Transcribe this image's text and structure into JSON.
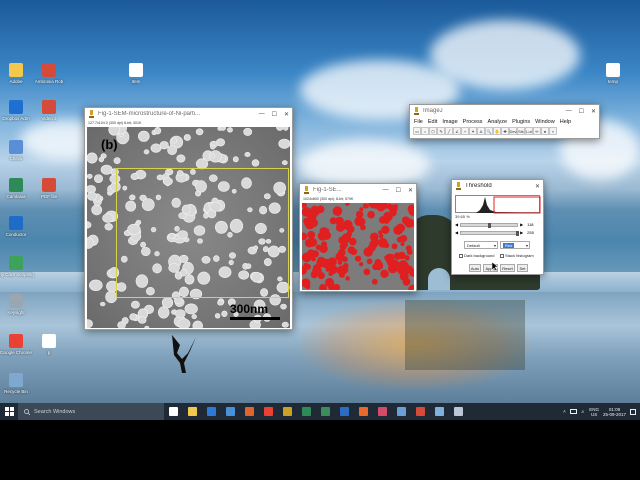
{
  "desktop": {
    "icons": [
      {
        "label": "Adobe",
        "color": "#f2c94c"
      },
      {
        "label": "Ambrosia Rob",
        "color": "#d44b3a"
      },
      {
        "label": "Dropbox Adm",
        "color": "#1f6fd1"
      },
      {
        "label": "Video 2",
        "color": "#d44b3a"
      },
      {
        "label": "Check",
        "color": "#5a8fd8"
      },
      {
        "label": "Camtasia",
        "color": "#2e8b57"
      },
      {
        "label": "PDF file",
        "color": "#d44b3a"
      },
      {
        "label": "Conductor",
        "color": "#1e6cc8"
      },
      {
        "label": "Fiji Core Scripting",
        "color": "#3da25a"
      },
      {
        "label": "Keysight",
        "color": "#9aa6b2"
      },
      {
        "label": "Google Chrome",
        "color": "#e94235"
      },
      {
        "label": "p",
        "color": "#ffffff"
      },
      {
        "label": "Recycle Bin",
        "color": "#7fa8d0"
      },
      {
        "label": "Item",
        "color": "#ffffff"
      },
      {
        "label": "temp",
        "color": "#ffffff"
      }
    ]
  },
  "imagej": {
    "title": "ImageJ",
    "menu": [
      "File",
      "Edit",
      "Image",
      "Process",
      "Analyze",
      "Plugins",
      "Window",
      "Help"
    ],
    "tools": [
      "rectangle-tool",
      "oval-tool",
      "polygon-tool",
      "freehand-tool",
      "line-tool",
      "angle-tool",
      "point-tool",
      "wand-tool",
      "text-tool",
      "magnifier-tool",
      "scroll-tool",
      "color-picker-tool",
      "dev-tool",
      "stk-tool",
      "lut-tool",
      "pencil-tool",
      "brush-tool",
      "more-tools"
    ]
  },
  "sem_window": {
    "title": "Fig-1-SEM-microstructure-of-Ni-parti...",
    "info": "127.7x104.0 (300 dpi) 8-bit; 301K",
    "panel_label": "(b)",
    "scale_label": "300nm"
  },
  "thresh_image_window": {
    "title": "Fig-1-SE...",
    "info": "1024x800 (300 dpi); 8-bit; 579K"
  },
  "threshold_dialog": {
    "title": "Threshold",
    "percent": "39.65 %",
    "min_value": "118",
    "max_value": "255",
    "method": "Default",
    "mode": "Red",
    "dark_background_label": "Dark background",
    "stack_histogram_label": "Stack histogram",
    "buttons": [
      "Auto",
      "Apply",
      "Reset",
      "Set"
    ]
  },
  "taskbar": {
    "search_placeholder": "Search Windows",
    "language": "ENG",
    "region": "US",
    "time": "01:09",
    "date": "25-09-2017",
    "pinned": [
      {
        "name": "task-view",
        "color": "#ffffff"
      },
      {
        "name": "file-explorer",
        "color": "#f2c94c"
      },
      {
        "name": "edge",
        "color": "#2b7bd6"
      },
      {
        "name": "store",
        "color": "#4a90d9"
      },
      {
        "name": "acrobat",
        "color": "#e0652d"
      },
      {
        "name": "chrome",
        "color": "#e94235"
      },
      {
        "name": "imagej",
        "color": "#c9a227"
      },
      {
        "name": "excel",
        "color": "#2e8b57"
      },
      {
        "name": "camtasia",
        "color": "#3d8c5c"
      },
      {
        "name": "word",
        "color": "#2b6cc4"
      },
      {
        "name": "firefox",
        "color": "#e66a2c"
      },
      {
        "name": "app-red",
        "color": "#d44b6a"
      },
      {
        "name": "photos",
        "color": "#6aa0d8"
      },
      {
        "name": "pdf-app",
        "color": "#d44b3a"
      },
      {
        "name": "notepad",
        "color": "#7fb1e0"
      },
      {
        "name": "app-window",
        "color": "#b9c7d6"
      }
    ]
  },
  "colors": {
    "taskbar": "#1f2a36",
    "threshold_red": "#e02020",
    "roi_yellow": "#d7d24a"
  }
}
